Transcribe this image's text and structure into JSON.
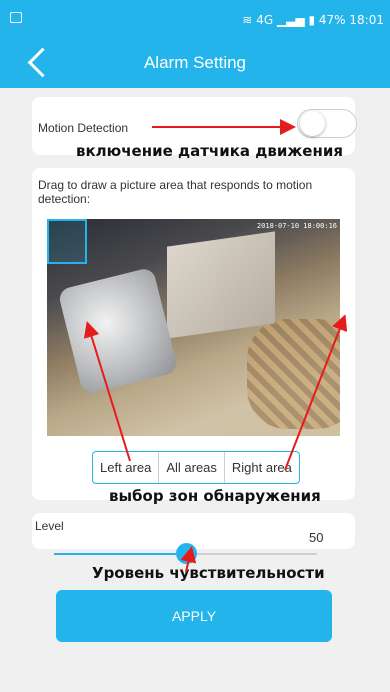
{
  "status_bar": {
    "right_text": "4G 47% 18:01",
    "network": "4G",
    "battery": "47%",
    "time": "18:01"
  },
  "header": {
    "title": "Alarm Setting"
  },
  "motion": {
    "label": "Motion Detection",
    "enabled": false
  },
  "area": {
    "description": "Drag to draw a picture area that responds to motion detection:",
    "camera_label": "",
    "timestamp": "2018-07-10 18:00:16",
    "buttons": [
      "Left area",
      "All areas",
      "Right area"
    ]
  },
  "level": {
    "label": "Level",
    "value": "50",
    "fraction": 0.5
  },
  "apply": {
    "label": "APPLY"
  },
  "annotations": {
    "motion_toggle": "включение датчика движения",
    "zones": "выбор зон обнаружения",
    "sensitivity": "Уровень чувствительности",
    "arrow_color": "#e61c1c"
  },
  "colors": {
    "accent": "#22b4ea",
    "background": "#f0f0f0"
  }
}
